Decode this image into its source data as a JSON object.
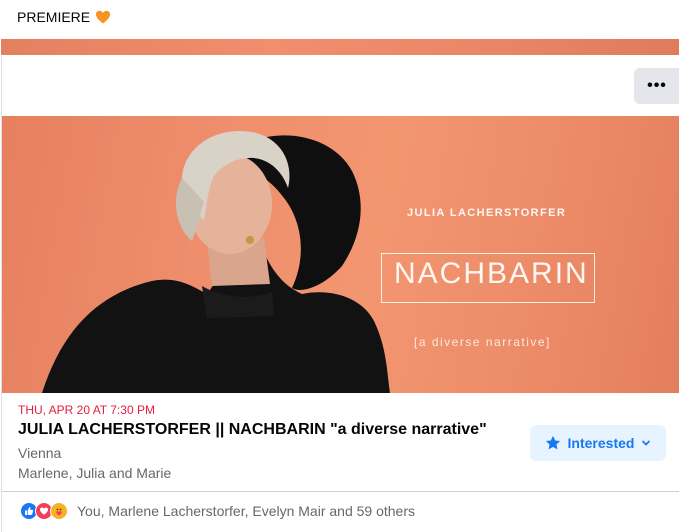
{
  "top_post": {
    "text": "PREMIERE",
    "emoji_icon": "orange-heart-icon"
  },
  "card": {
    "more_button_label": "•••",
    "cover": {
      "artist": "JULIA LACHERSTORFER",
      "title": "NACHBARIN",
      "subtitle": "[a diverse narrative]"
    },
    "date": "THU, APR 20 AT 7:30 PM",
    "title": "JULIA LACHERSTORFER || NACHBARIN \"a diverse narrative\"",
    "location": "Vienna",
    "friends": "Marlene, Julia and Marie",
    "interested_label": "Interested",
    "reactions": {
      "icons": [
        "like-icon",
        "love-icon",
        "care-icon"
      ],
      "text": "You, Marlene Lacherstorfer, Evelyn Mair and 59 others"
    }
  },
  "colors": {
    "accent": "#1877f2",
    "date_red": "#e41e3f",
    "cover_orange": "#ef8e6c"
  }
}
